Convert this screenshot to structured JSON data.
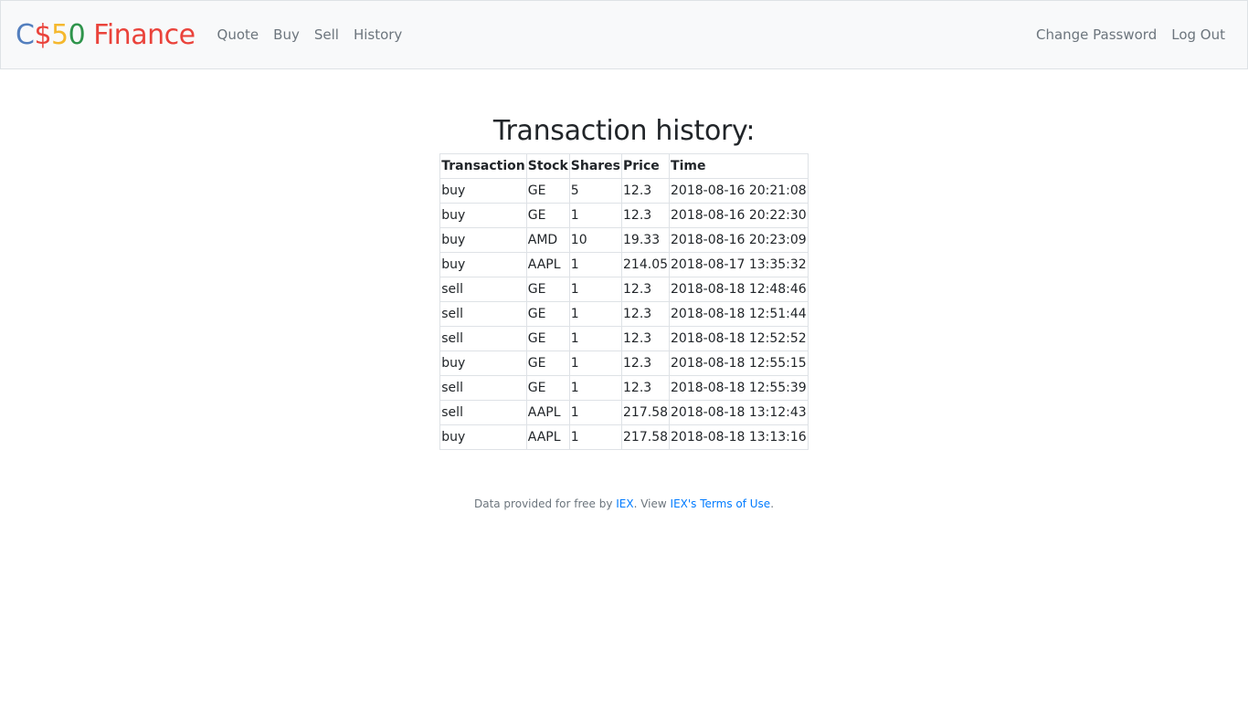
{
  "navbar": {
    "brand": {
      "parts": [
        {
          "text": "C",
          "color": "#537fbe"
        },
        {
          "text": "$",
          "color": "#ea433b"
        },
        {
          "text": "5",
          "color": "#f5b82e"
        },
        {
          "text": "0",
          "color": "#2e944b"
        },
        {
          "text": " Finance",
          "color": "#ea433b"
        }
      ]
    },
    "left_links": [
      "Quote",
      "Buy",
      "Sell",
      "History"
    ],
    "right_links": [
      "Change Password",
      "Log Out"
    ]
  },
  "main": {
    "title": "Transaction history:",
    "table": {
      "headers": [
        "Transaction",
        "Stock",
        "Shares",
        "Price",
        "Time"
      ],
      "rows": [
        [
          "buy",
          "GE",
          "5",
          "12.3",
          "2018-08-16 20:21:08"
        ],
        [
          "buy",
          "GE",
          "1",
          "12.3",
          "2018-08-16 20:22:30"
        ],
        [
          "buy",
          "AMD",
          "10",
          "19.33",
          "2018-08-16 20:23:09"
        ],
        [
          "buy",
          "AAPL",
          "1",
          "214.05",
          "2018-08-17 13:35:32"
        ],
        [
          "sell",
          "GE",
          "1",
          "12.3",
          "2018-08-18 12:48:46"
        ],
        [
          "sell",
          "GE",
          "1",
          "12.3",
          "2018-08-18 12:51:44"
        ],
        [
          "sell",
          "GE",
          "1",
          "12.3",
          "2018-08-18 12:52:52"
        ],
        [
          "buy",
          "GE",
          "1",
          "12.3",
          "2018-08-18 12:55:15"
        ],
        [
          "sell",
          "GE",
          "1",
          "12.3",
          "2018-08-18 12:55:39"
        ],
        [
          "sell",
          "AAPL",
          "1",
          "217.58",
          "2018-08-18 13:12:43"
        ],
        [
          "buy",
          "AAPL",
          "1",
          "217.58",
          "2018-08-18 13:13:16"
        ]
      ]
    }
  },
  "footer": {
    "prefix": "Data provided for free by ",
    "iex_link": "IEX",
    "middle": ". View ",
    "terms_link": "IEX's Terms of Use",
    "suffix": "."
  }
}
